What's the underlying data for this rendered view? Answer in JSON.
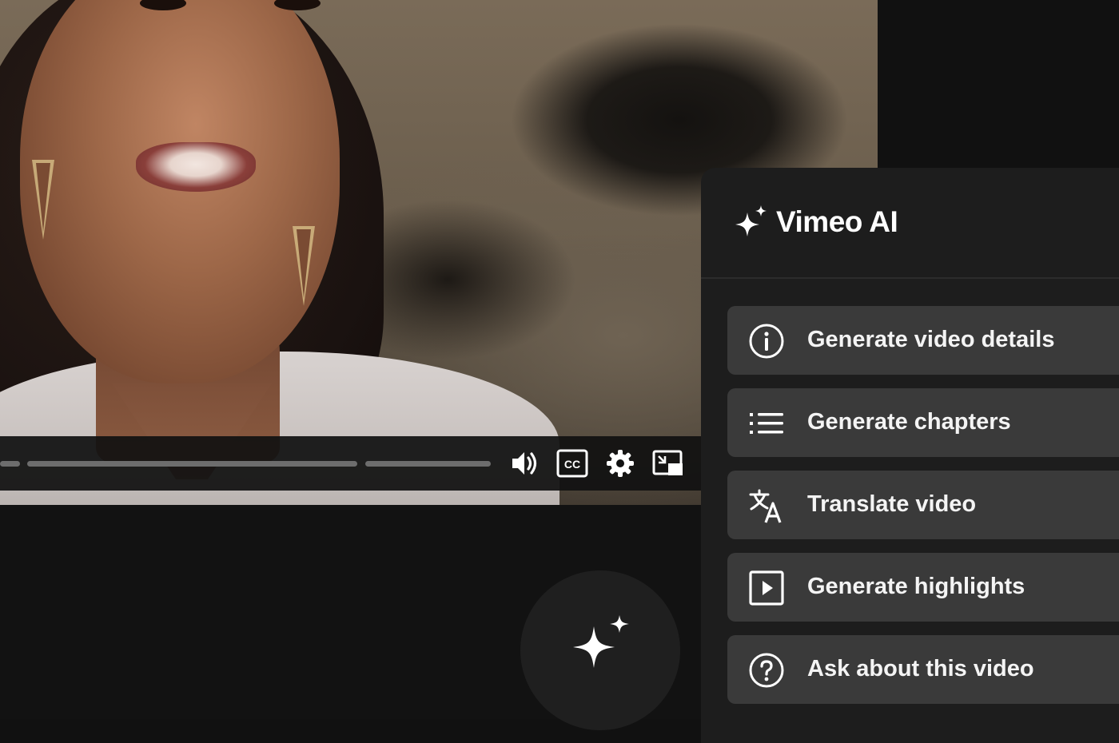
{
  "panel": {
    "title": "Vimeo AI",
    "actions": [
      {
        "label": "Generate video details",
        "icon": "info-circle-icon"
      },
      {
        "label": "Generate chapters",
        "icon": "list-icon"
      },
      {
        "label": "Translate video",
        "icon": "translate-icon"
      },
      {
        "label": "Generate highlights",
        "icon": "play-square-icon"
      },
      {
        "label": "Ask about this video",
        "icon": "question-circle-icon"
      }
    ]
  },
  "player": {
    "cc_label": "CC",
    "controls": [
      "volume-icon",
      "captions-icon",
      "settings-icon",
      "picture-in-picture-icon"
    ]
  },
  "colors": {
    "background": "#111111",
    "panel": "#1d1d1d",
    "action_bg": "#3a3a3a",
    "text": "#ffffff",
    "progress": "#6d6d6d"
  }
}
